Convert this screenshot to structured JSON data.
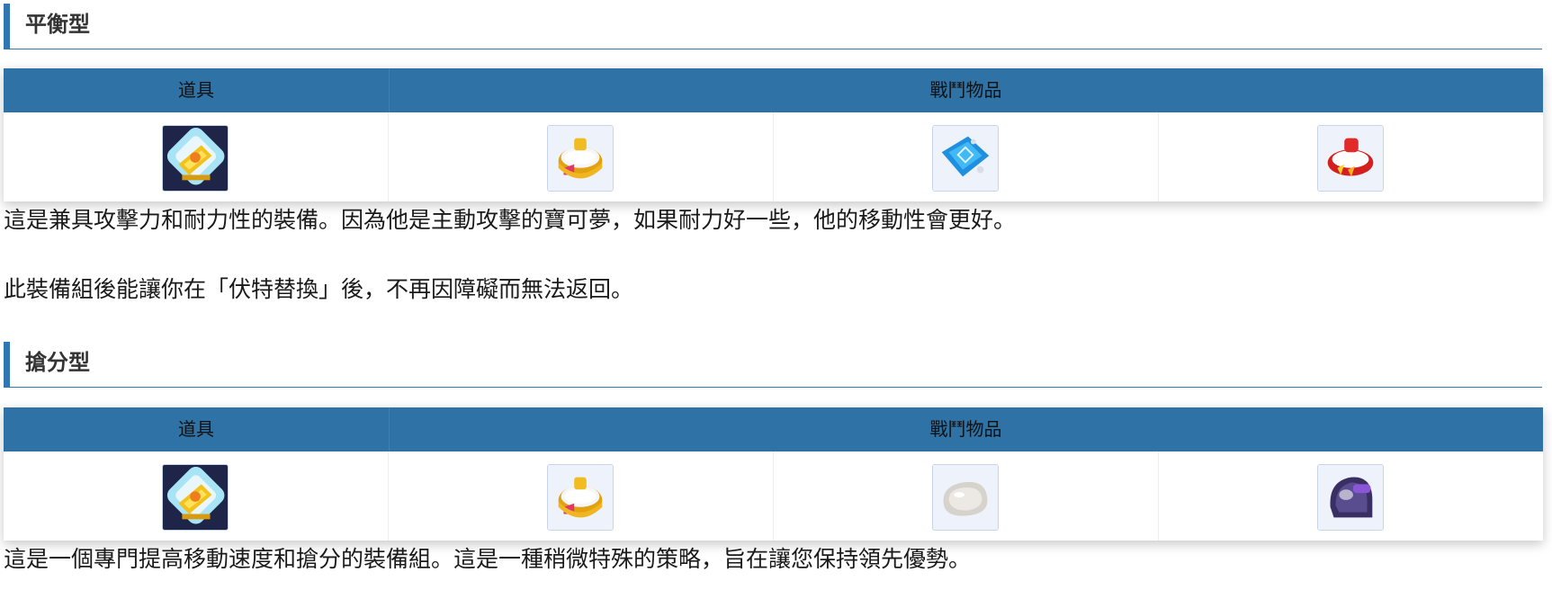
{
  "sections": [
    {
      "title": "平衡型",
      "header": {
        "col_items": "道具",
        "col_battle": "戰鬥物品"
      },
      "icons": [
        "x-speed-icon",
        "muscle-band-icon",
        "focus-band-icon",
        "attack-weight-icon"
      ],
      "paragraphs": [
        "這是兼具攻擊力和耐力性的裝備。因為他是主動攻擊的寶可夢，如果耐力好一些，他的移動性會更好。",
        "此裝備組後能讓你在「伏特替換」後，不再因障礙而無法返回。"
      ]
    },
    {
      "title": "搶分型",
      "header": {
        "col_items": "道具",
        "col_battle": "戰鬥物品"
      },
      "icons": [
        "x-speed-icon",
        "muscle-band-icon",
        "float-stone-icon",
        "rocky-helmet-icon"
      ],
      "paragraphs": [
        "這是一個專門提高移動速度和搶分的裝備組。這是一種稍微特殊的策略，旨在讓您保持領先優勢。"
      ]
    }
  ]
}
